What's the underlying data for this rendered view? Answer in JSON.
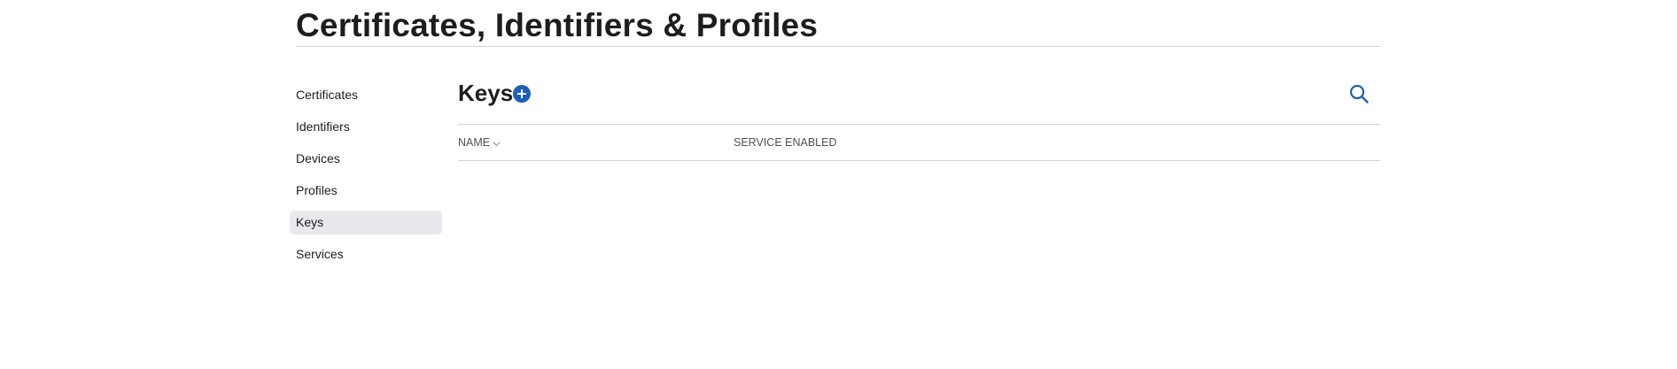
{
  "header": {
    "title": "Certificates, Identifiers & Profiles"
  },
  "sidebar": {
    "items": [
      {
        "label": "Certificates",
        "active": false
      },
      {
        "label": "Identifiers",
        "active": false
      },
      {
        "label": "Devices",
        "active": false
      },
      {
        "label": "Profiles",
        "active": false
      },
      {
        "label": "Keys",
        "active": true
      },
      {
        "label": "Services",
        "active": false
      }
    ]
  },
  "main": {
    "title": "Keys",
    "add_icon": "plus-circle-icon",
    "search_icon": "search-icon",
    "table": {
      "columns": [
        {
          "label": "NAME",
          "sort_icon": "chevron-down-icon"
        },
        {
          "label": "SERVICE ENABLED"
        }
      ],
      "rows": []
    }
  },
  "colors": {
    "accent": "#1e5fb8",
    "active_bg": "#e8e8ed",
    "divider": "#d2d2d7",
    "text": "#1d1d1f"
  }
}
